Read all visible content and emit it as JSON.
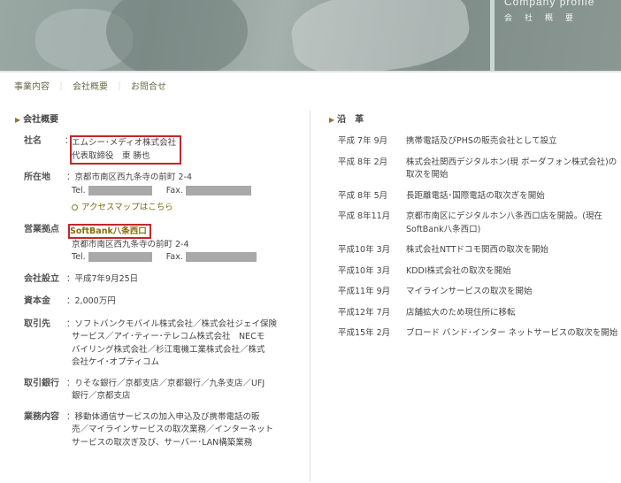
{
  "header": {
    "title": "Company profile",
    "subtitle": "会社概要"
  },
  "nav": {
    "items": [
      "事業内容",
      "会社概要",
      "お問合せ"
    ],
    "separator": "｜"
  },
  "left": {
    "section_title": "会社概要",
    "rows": {
      "name": {
        "label": "社名",
        "line1": "エムシー･メディオ株式会社",
        "line2": "代表取締役　東 勝也"
      },
      "address": {
        "label": "所在地",
        "line1": "：京都市南区西九条寺の前町 2-4",
        "tel": "Tel.",
        "fax": "Fax.",
        "map_link": "アクセスマップはこちら"
      },
      "shop": {
        "label": "営業拠点",
        "shop_name": "SoftBank八条西口",
        "line1": "京都市南区西九条寺の前町 2-4",
        "tel": "Tel.",
        "fax": "Fax."
      },
      "founded": {
        "label": "会社設立",
        "value": "：平成7年9月25日"
      },
      "capital": {
        "label": "資本金",
        "value": "：2,000万円"
      },
      "partners": {
        "label": "取引先",
        "value1": "：ソフトバンクモバイル株式会社／株式会社ジェイ保険",
        "value2": "サービス／アイ･ティー･テレコム株式会社　NECモ",
        "value3": "バイリング株式会社／杉江電機工業株式会社／株式",
        "value4": "会社ケイ･オプティコム"
      },
      "banks": {
        "label": "取引銀行",
        "value1": "：りそな銀行／京都支店／京都銀行／九条支店／UFJ",
        "value2": "銀行／京都支店"
      },
      "business": {
        "label": "業務内容",
        "value1": "：移動体通信サービスの加入申込及び携帯電話の販",
        "value2": "売／マイラインサービスの取次業務／インターネット",
        "value3": "サービスの取次ぎ及び、サーバー･LAN構築業務"
      }
    },
    "name_colon": "："
  },
  "right": {
    "section_title": "沿　革",
    "history": [
      {
        "date": "平成 7年 9月",
        "text": "携帯電話及びPHSの販売会社として設立"
      },
      {
        "date": "平成 8年 2月",
        "text": "株式会社関西デジタルホン(現 ボーダフォン株式会社)の取次を開始"
      },
      {
        "date": "平成 8年 5月",
        "text": "長距離電話･国際電話の取次ぎを開始"
      },
      {
        "date": "平成 8年11月",
        "text": "京都市南区にデジタルホン八条西口店を開設。(現在 SoftBank八条西口)"
      },
      {
        "date": "平成10年 3月",
        "text": "株式会社NTTドコモ関西の取次を開始"
      },
      {
        "date": "平成10年 3月",
        "text": "KDDI株式会社の取次を開始"
      },
      {
        "date": "平成11年 9月",
        "text": "マイラインサービスの取次を開始"
      },
      {
        "date": "平成12年 7月",
        "text": "店舗拡大のため現住所に移転"
      },
      {
        "date": "平成15年 2月",
        "text": "ブロード バンド･インター ネットサービスの取次を開始"
      }
    ]
  }
}
